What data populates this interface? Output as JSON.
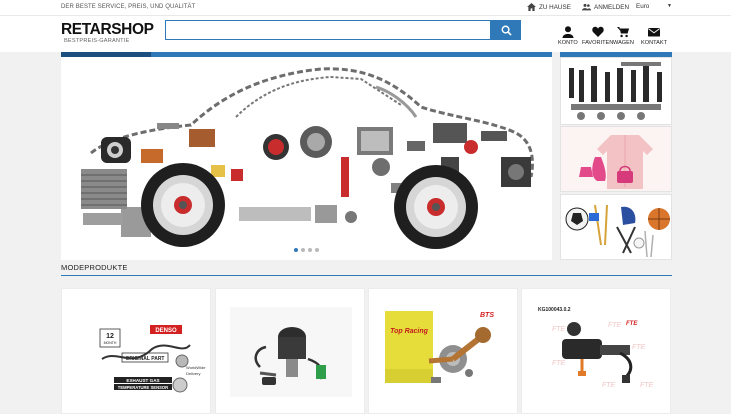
{
  "topbar": {
    "tagline": "DER BESTE SERVICE, PREIS, UND QUALITÄT",
    "home_label": "ZU HAUSE",
    "login_label": "ANMELDEN",
    "currency": "Euro",
    "currency_caret": "▼"
  },
  "header": {
    "logo": "RETARSHOP",
    "logo_sub": "BESTPREIS-GARANTIE",
    "search_value": "",
    "nav": [
      {
        "label": "KONTO",
        "icon": "user-icon"
      },
      {
        "label": "FAVORITEN",
        "icon": "heart-icon"
      },
      {
        "label": "WAGEN",
        "icon": "cart-icon"
      },
      {
        "label": "KONTAKT",
        "icon": "envelope-icon"
      }
    ]
  },
  "slider": {
    "slide_count": 4,
    "active_slide": 1
  },
  "section": {
    "title": "MODEPRODUKTE"
  },
  "products": [
    {
      "name": "oxygen-sensor",
      "brand_box": "12",
      "brand_box2": "MONTH",
      "brand": "DENSO",
      "tag": "ORIGINAL PART",
      "note1": "WorldWide",
      "note2": "Delivery",
      "caption1": "EXHAUST GAS",
      "caption2": "TEMPERATURE SENSOR"
    },
    {
      "name": "ignition-switch"
    },
    {
      "name": "crankshaft",
      "box_label": "Top Racing",
      "brand": "BTS"
    },
    {
      "name": "brake-master-cylinder",
      "code": "KG100043.0.2",
      "brand": "FTE"
    }
  ],
  "colors": {
    "accent": "#2f79b9",
    "accent_dark": "#1b4f80",
    "background": "#f1f1f1"
  }
}
